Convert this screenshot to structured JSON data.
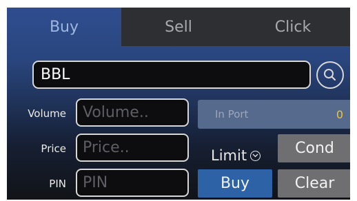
{
  "tabs": [
    {
      "label": "Buy",
      "active": true
    },
    {
      "label": "Sell",
      "active": false
    },
    {
      "label": "Click",
      "active": false
    }
  ],
  "symbol": {
    "value": "BBL"
  },
  "search": {
    "icon": "search-icon"
  },
  "form": {
    "volume_label": "Volume",
    "volume_placeholder": "Volume..",
    "price_label": "Price",
    "price_placeholder": "Price..",
    "pin_label": "PIN",
    "pin_placeholder": "PIN"
  },
  "inport": {
    "label": "In Port",
    "value": "0"
  },
  "order_type": {
    "label": "Limit",
    "icon": "chevron-down-icon"
  },
  "buttons": {
    "cond": "Cond",
    "buy": "Buy",
    "clear": "Clear"
  },
  "colors": {
    "active_tab_text": "#9fb6de",
    "inport_value": "#f4c430",
    "buy_button": "#2d63a6",
    "gray_button": "#6f6f71"
  }
}
